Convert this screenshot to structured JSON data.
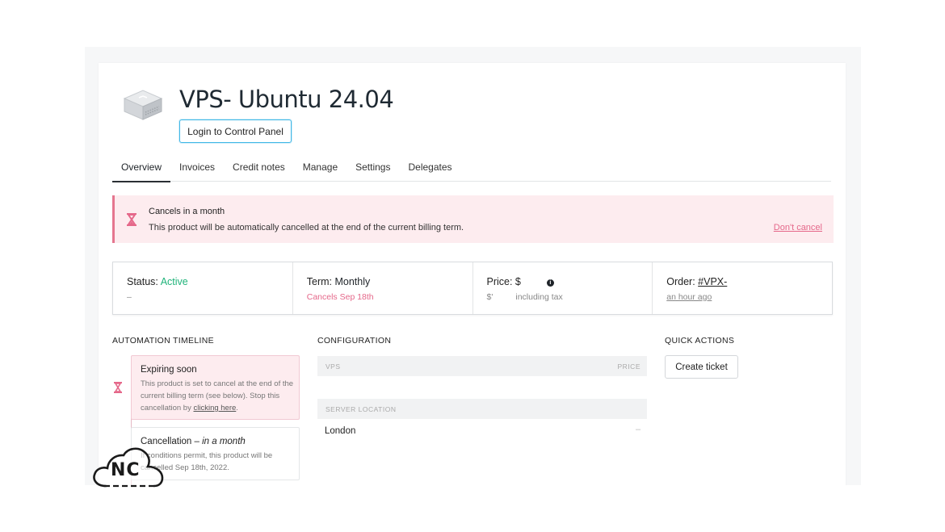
{
  "product": {
    "title": "VPS- Ubuntu 24.04",
    "login_button": "Login to Control Panel",
    "icon": "server-box-icon"
  },
  "tabs": [
    {
      "label": "Overview",
      "active": true
    },
    {
      "label": "Invoices",
      "active": false
    },
    {
      "label": "Credit notes",
      "active": false
    },
    {
      "label": "Manage",
      "active": false
    },
    {
      "label": "Settings",
      "active": false
    },
    {
      "label": "Delegates",
      "active": false
    }
  ],
  "alert": {
    "icon": "hourglass-icon",
    "title": "Cancels in a month",
    "text": "This product will be automatically cancelled at the end of the current billing term.",
    "link": "Don't cancel"
  },
  "stats": {
    "status_label": "Status:",
    "status_value": "Active",
    "status_sub": "–",
    "term_label": "Term:",
    "term_value": "Monthly",
    "term_sub": "Cancels Sep 18th",
    "price_label": "Price: $",
    "price_sub_currency": "$'",
    "price_sub_text": "including tax",
    "info_icon": "info-icon",
    "order_label": "Order:",
    "order_value": "#VPX-",
    "order_sub": "an hour ago"
  },
  "timeline": {
    "heading": "AUTOMATION TIMELINE",
    "items": [
      {
        "title": "Expiring soon",
        "text_before_link": "This product is set to cancel at the end of the current billing term (see below). Stop this cancellation by ",
        "link": "clicking here",
        "text_after_link": "."
      },
      {
        "title": "Cancellation",
        "title_suffix": "in a month",
        "text": "If conditions permit, this product will be cancelled Sep 18th, 2022."
      }
    ]
  },
  "configuration": {
    "heading": "CONFIGURATION",
    "header_left": "VPS",
    "header_right": "PRICE",
    "location_header": "SERVER LOCATION",
    "location_value": "London",
    "location_price": "–"
  },
  "quick_actions": {
    "heading": "QUICK ACTIONS",
    "create_ticket": "Create ticket"
  },
  "watermark": {
    "text": "NC"
  },
  "colors": {
    "accent_blue": "#42b8e6",
    "alert_pink": "#e5688a",
    "alert_bg": "#fdecef",
    "status_green": "#20b37a"
  }
}
